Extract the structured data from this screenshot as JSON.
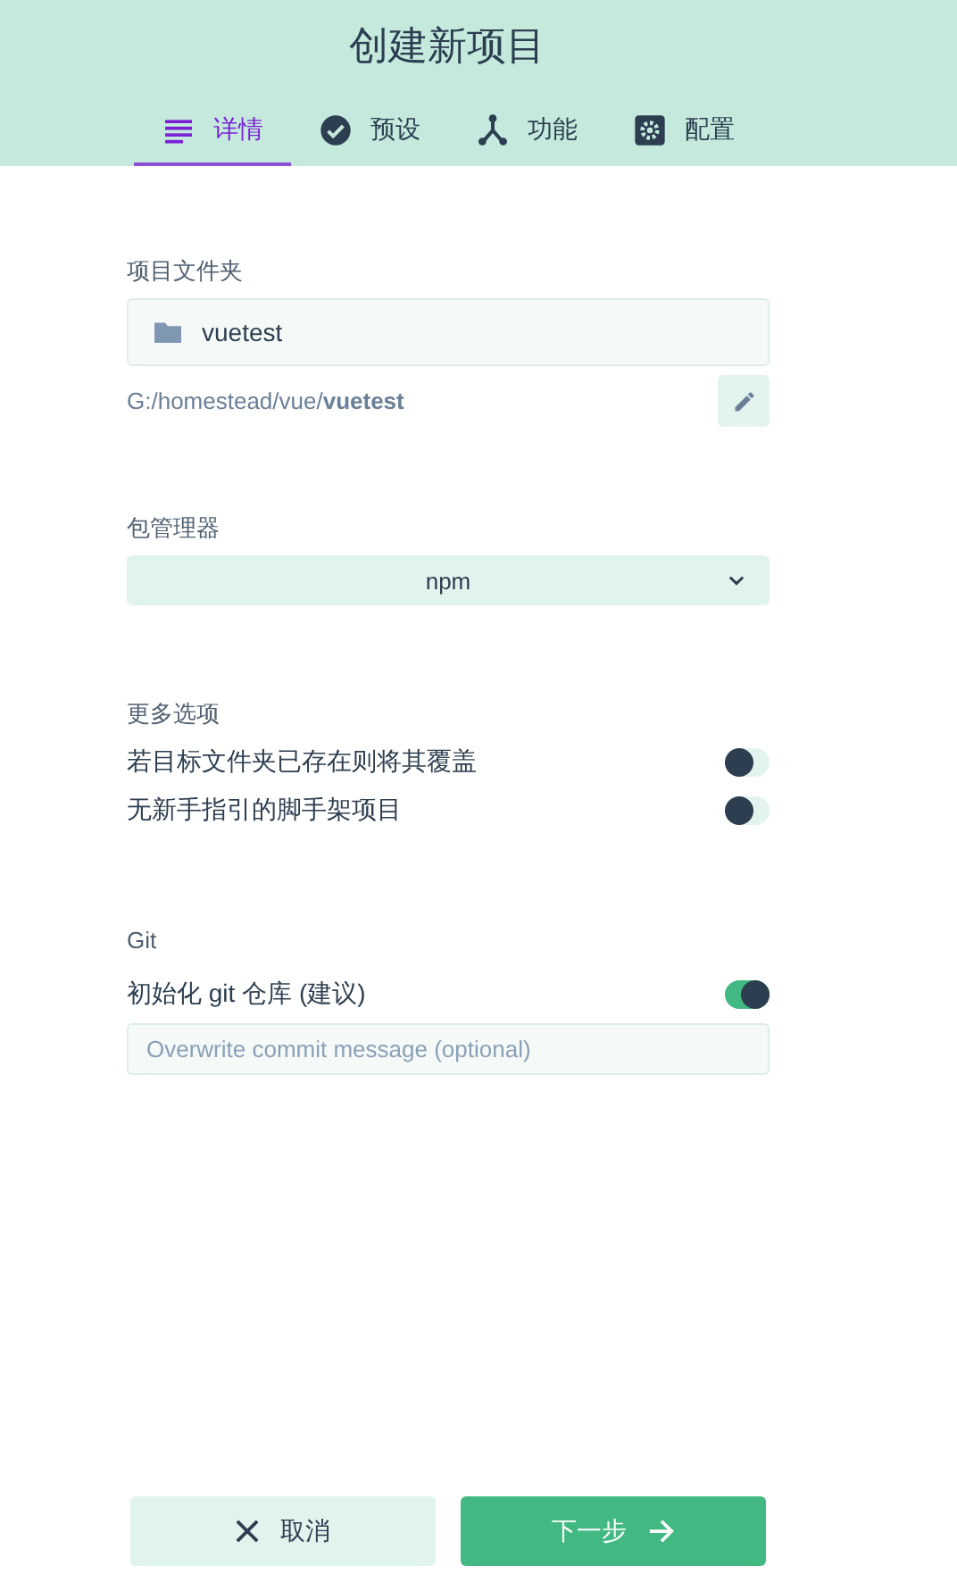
{
  "header": {
    "title": "创建新项目"
  },
  "tabs": [
    {
      "label": "详情",
      "kind": "details",
      "selected": true
    },
    {
      "label": "预设",
      "kind": "check",
      "selected": false
    },
    {
      "label": "功能",
      "kind": "fork",
      "selected": false
    },
    {
      "label": "配置",
      "kind": "gear",
      "selected": false
    }
  ],
  "folder": {
    "label": "项目文件夹",
    "value": "vuetest",
    "path": "G:/homestead/vue/**vuetest**"
  },
  "package_manager": {
    "label": "包管理器",
    "value": "npm"
  },
  "more_options": {
    "label": "更多选项",
    "options": [
      {
        "label": "若目标文件夹已存在则将其覆盖",
        "on": false
      },
      {
        "label": "无新手指引的脚手架项目",
        "on": false
      }
    ]
  },
  "git": {
    "label": "Git",
    "options": [
      {
        "label": "初始化 git 仓库 (建议)",
        "on": true
      }
    ],
    "commit": {
      "placeholder": "Overwrite commit message (optional)"
    }
  },
  "buttons": [
    {
      "label": "取消",
      "kind": "cancel"
    },
    {
      "label": "下一步",
      "kind": "next"
    }
  ]
}
